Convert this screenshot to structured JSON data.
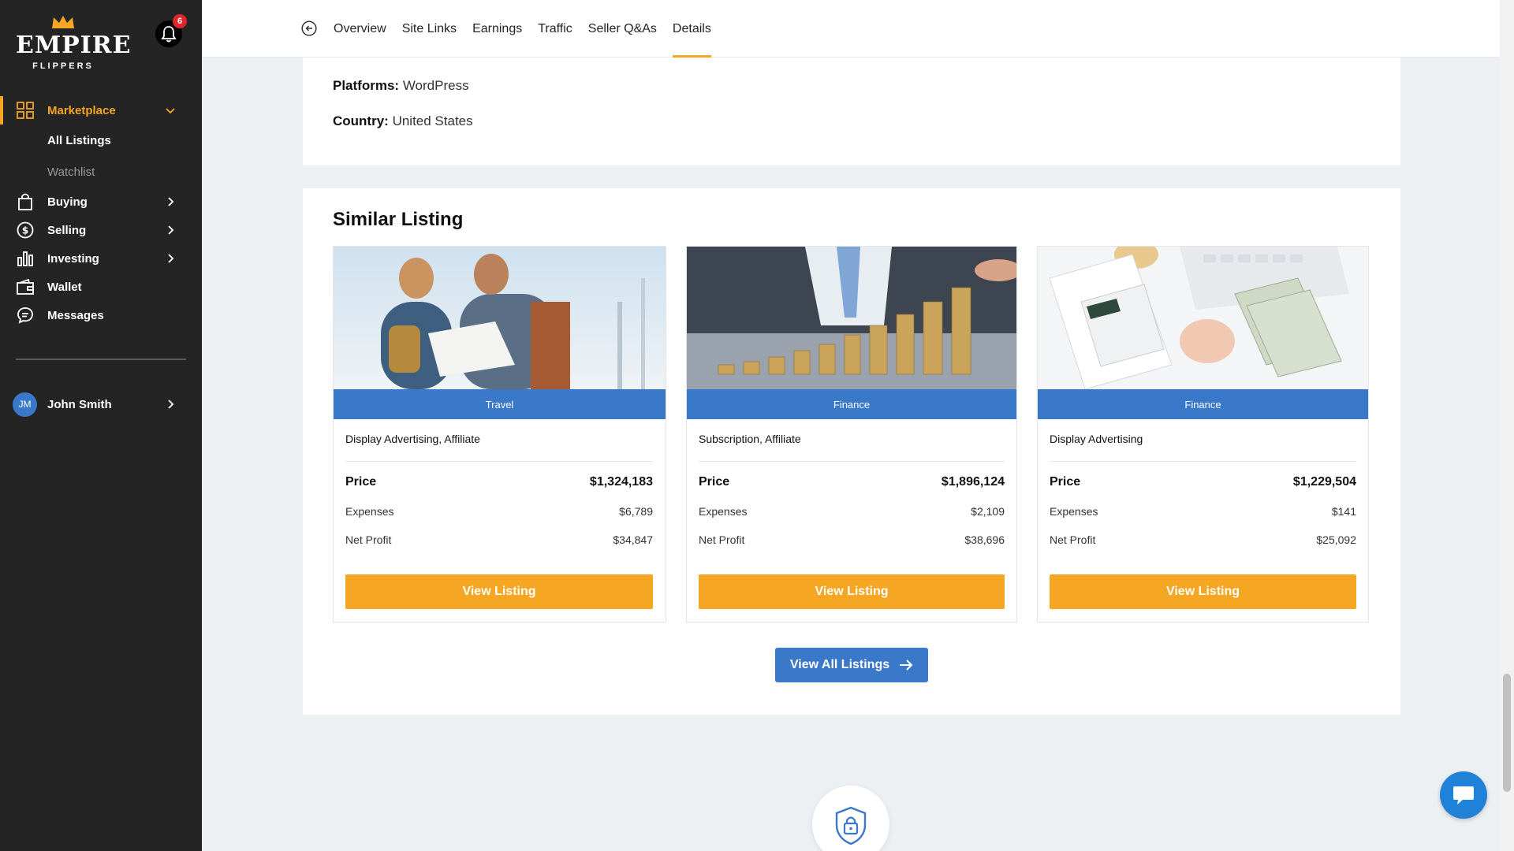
{
  "brand": {
    "name": "EMPIRE",
    "sub": "FLIPPERS"
  },
  "notifications": {
    "count": "6"
  },
  "sidebar": {
    "items": [
      {
        "label": "Marketplace",
        "icon": "grid-icon",
        "active": true
      },
      {
        "label": "Buying",
        "icon": "shopping-bag-icon"
      },
      {
        "label": "Selling",
        "icon": "dollar-circle-icon"
      },
      {
        "label": "Investing",
        "icon": "bar-chart-icon"
      },
      {
        "label": "Wallet",
        "icon": "wallet-icon"
      },
      {
        "label": "Messages",
        "icon": "chat-icon"
      }
    ],
    "sub_items": [
      {
        "label": "All Listings"
      },
      {
        "label": "Watchlist"
      }
    ]
  },
  "user": {
    "initials": "JM",
    "name": "John Smith"
  },
  "tabs": [
    {
      "label": "Overview"
    },
    {
      "label": "Site Links"
    },
    {
      "label": "Earnings"
    },
    {
      "label": "Traffic"
    },
    {
      "label": "Seller Q&As"
    },
    {
      "label": "Details",
      "active": true
    }
  ],
  "details": {
    "platforms_label": "Platforms:",
    "platforms_value": "WordPress",
    "country_label": "Country:",
    "country_value": "United States"
  },
  "similar": {
    "title": "Similar Listing",
    "price_label": "Price",
    "expenses_label": "Expenses",
    "net_profit_label": "Net Profit",
    "view_label": "View Listing",
    "listings": [
      {
        "category": "Travel",
        "monetization": "Display Advertising, Affiliate",
        "price": "$1,324,183",
        "expenses": "$6,789",
        "net_profit": "$34,847"
      },
      {
        "category": "Finance",
        "monetization": "Subscription, Affiliate",
        "price": "$1,896,124",
        "expenses": "$2,109",
        "net_profit": "$38,696"
      },
      {
        "category": "Finance",
        "monetization": "Display Advertising",
        "price": "$1,229,504",
        "expenses": "$141",
        "net_profit": "$25,092"
      }
    ],
    "view_all_label": "View All Listings"
  },
  "colors": {
    "accent": "#f5a623",
    "primary": "#3a78c9",
    "sidebar_bg": "#242424"
  }
}
